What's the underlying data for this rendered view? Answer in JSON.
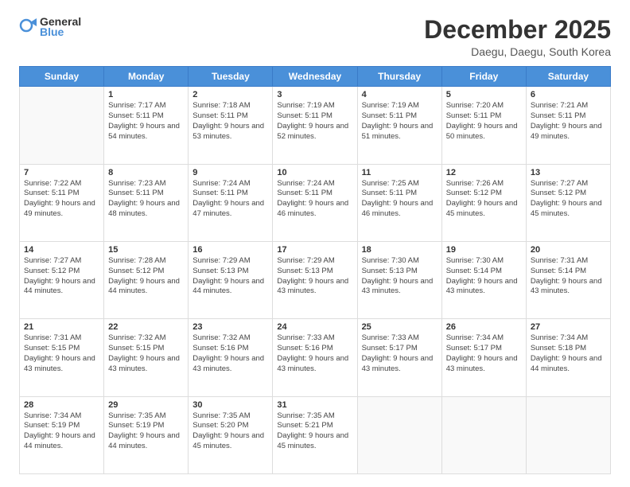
{
  "header": {
    "logo_general": "General",
    "logo_blue": "Blue",
    "month": "December 2025",
    "location": "Daegu, Daegu, South Korea"
  },
  "days_of_week": [
    "Sunday",
    "Monday",
    "Tuesday",
    "Wednesday",
    "Thursday",
    "Friday",
    "Saturday"
  ],
  "weeks": [
    [
      {
        "day": "",
        "sunrise": "",
        "sunset": "",
        "daylight": ""
      },
      {
        "day": "1",
        "sunrise": "7:17 AM",
        "sunset": "5:11 PM",
        "daylight": "9 hours and 54 minutes."
      },
      {
        "day": "2",
        "sunrise": "7:18 AM",
        "sunset": "5:11 PM",
        "daylight": "9 hours and 53 minutes."
      },
      {
        "day": "3",
        "sunrise": "7:19 AM",
        "sunset": "5:11 PM",
        "daylight": "9 hours and 52 minutes."
      },
      {
        "day": "4",
        "sunrise": "7:19 AM",
        "sunset": "5:11 PM",
        "daylight": "9 hours and 51 minutes."
      },
      {
        "day": "5",
        "sunrise": "7:20 AM",
        "sunset": "5:11 PM",
        "daylight": "9 hours and 50 minutes."
      },
      {
        "day": "6",
        "sunrise": "7:21 AM",
        "sunset": "5:11 PM",
        "daylight": "9 hours and 49 minutes."
      }
    ],
    [
      {
        "day": "7",
        "sunrise": "7:22 AM",
        "sunset": "5:11 PM",
        "daylight": "9 hours and 49 minutes."
      },
      {
        "day": "8",
        "sunrise": "7:23 AM",
        "sunset": "5:11 PM",
        "daylight": "9 hours and 48 minutes."
      },
      {
        "day": "9",
        "sunrise": "7:24 AM",
        "sunset": "5:11 PM",
        "daylight": "9 hours and 47 minutes."
      },
      {
        "day": "10",
        "sunrise": "7:24 AM",
        "sunset": "5:11 PM",
        "daylight": "9 hours and 46 minutes."
      },
      {
        "day": "11",
        "sunrise": "7:25 AM",
        "sunset": "5:11 PM",
        "daylight": "9 hours and 46 minutes."
      },
      {
        "day": "12",
        "sunrise": "7:26 AM",
        "sunset": "5:12 PM",
        "daylight": "9 hours and 45 minutes."
      },
      {
        "day": "13",
        "sunrise": "7:27 AM",
        "sunset": "5:12 PM",
        "daylight": "9 hours and 45 minutes."
      }
    ],
    [
      {
        "day": "14",
        "sunrise": "7:27 AM",
        "sunset": "5:12 PM",
        "daylight": "9 hours and 44 minutes."
      },
      {
        "day": "15",
        "sunrise": "7:28 AM",
        "sunset": "5:12 PM",
        "daylight": "9 hours and 44 minutes."
      },
      {
        "day": "16",
        "sunrise": "7:29 AM",
        "sunset": "5:13 PM",
        "daylight": "9 hours and 44 minutes."
      },
      {
        "day": "17",
        "sunrise": "7:29 AM",
        "sunset": "5:13 PM",
        "daylight": "9 hours and 43 minutes."
      },
      {
        "day": "18",
        "sunrise": "7:30 AM",
        "sunset": "5:13 PM",
        "daylight": "9 hours and 43 minutes."
      },
      {
        "day": "19",
        "sunrise": "7:30 AM",
        "sunset": "5:14 PM",
        "daylight": "9 hours and 43 minutes."
      },
      {
        "day": "20",
        "sunrise": "7:31 AM",
        "sunset": "5:14 PM",
        "daylight": "9 hours and 43 minutes."
      }
    ],
    [
      {
        "day": "21",
        "sunrise": "7:31 AM",
        "sunset": "5:15 PM",
        "daylight": "9 hours and 43 minutes."
      },
      {
        "day": "22",
        "sunrise": "7:32 AM",
        "sunset": "5:15 PM",
        "daylight": "9 hours and 43 minutes."
      },
      {
        "day": "23",
        "sunrise": "7:32 AM",
        "sunset": "5:16 PM",
        "daylight": "9 hours and 43 minutes."
      },
      {
        "day": "24",
        "sunrise": "7:33 AM",
        "sunset": "5:16 PM",
        "daylight": "9 hours and 43 minutes."
      },
      {
        "day": "25",
        "sunrise": "7:33 AM",
        "sunset": "5:17 PM",
        "daylight": "9 hours and 43 minutes."
      },
      {
        "day": "26",
        "sunrise": "7:34 AM",
        "sunset": "5:17 PM",
        "daylight": "9 hours and 43 minutes."
      },
      {
        "day": "27",
        "sunrise": "7:34 AM",
        "sunset": "5:18 PM",
        "daylight": "9 hours and 44 minutes."
      }
    ],
    [
      {
        "day": "28",
        "sunrise": "7:34 AM",
        "sunset": "5:19 PM",
        "daylight": "9 hours and 44 minutes."
      },
      {
        "day": "29",
        "sunrise": "7:35 AM",
        "sunset": "5:19 PM",
        "daylight": "9 hours and 44 minutes."
      },
      {
        "day": "30",
        "sunrise": "7:35 AM",
        "sunset": "5:20 PM",
        "daylight": "9 hours and 45 minutes."
      },
      {
        "day": "31",
        "sunrise": "7:35 AM",
        "sunset": "5:21 PM",
        "daylight": "9 hours and 45 minutes."
      },
      {
        "day": "",
        "sunrise": "",
        "sunset": "",
        "daylight": ""
      },
      {
        "day": "",
        "sunrise": "",
        "sunset": "",
        "daylight": ""
      },
      {
        "day": "",
        "sunrise": "",
        "sunset": "",
        "daylight": ""
      }
    ]
  ]
}
